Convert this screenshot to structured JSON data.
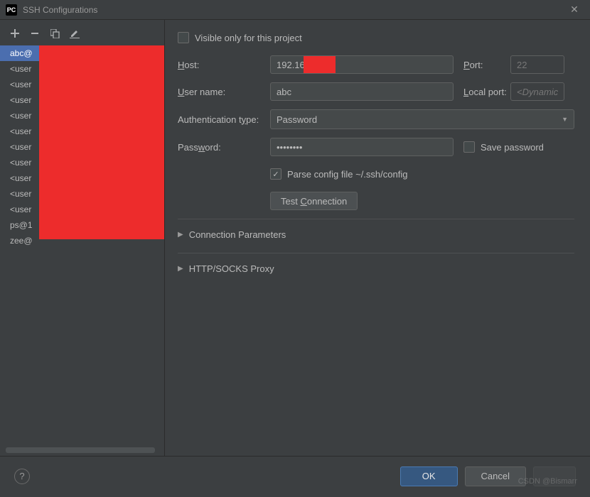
{
  "window": {
    "app_icon_text": "PC",
    "title": "SSH Configurations"
  },
  "toolbar": {
    "add": "+",
    "remove": "−",
    "copy_icon": "copy-icon",
    "edit_icon": "edit-icon"
  },
  "configs": [
    "abc@",
    "<user",
    "<user",
    "<user",
    "<user",
    "<user",
    "<user",
    "<user",
    "<user",
    "<user",
    "<user",
    "ps@1",
    "zee@"
  ],
  "form": {
    "visible_only_label": "Visible only for this project",
    "visible_only_checked": false,
    "host_label": "Host:",
    "host_value": "192.168",
    "port_label": "Port:",
    "port_value": "22",
    "username_label": "User name:",
    "username_value": "abc",
    "local_port_label": "Local port:",
    "local_port_placeholder": "<Dynamic>",
    "auth_type_label": "Authentication type:",
    "auth_type_value": "Password",
    "password_label": "Password:",
    "password_value": "••••••••",
    "save_password_label": "Save password",
    "save_password_checked": false,
    "parse_config_label": "Parse config file ~/.ssh/config",
    "parse_config_checked": true,
    "test_connection_label": "Test Connection"
  },
  "expanders": {
    "connection_params": "Connection Parameters",
    "proxy": "HTTP/SOCKS Proxy"
  },
  "footer": {
    "ok": "OK",
    "cancel": "Cancel"
  },
  "watermark": "CSDN @Bismarr"
}
